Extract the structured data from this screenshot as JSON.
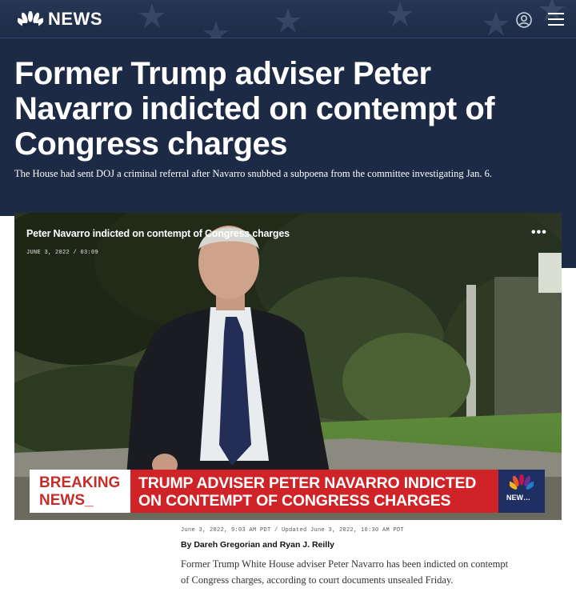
{
  "header": {
    "logo_text": "NEWS",
    "icons": [
      "nbc-peacock-icon",
      "account-icon",
      "hamburger-menu-icon"
    ],
    "colors": {
      "nav_bg": "#1d2c47",
      "hero_bg": "#1c2a45"
    }
  },
  "article": {
    "headline": "Former Trump adviser Peter Navarro indicted on contempt of Congress charges",
    "dek": "The House had sent DOJ a criminal referral after Navarro snubbed a subpoena from the committee investigating Jan. 6.",
    "timestamp": "June 3, 2022, 9:03 AM PDT / Updated June 3, 2022, 10:30 AM PDT",
    "byline": "By Dareh Gregorian and Ryan J. Reilly",
    "body": "Former Trump White House adviser Peter Navarro has been indicted on contempt of Congress charges, according to court documents unsealed Friday."
  },
  "video": {
    "title": "Peter Navarro indicted on contempt of Congress charges",
    "meta": "JUNE 3, 2022 / 03:09",
    "more_label": "•••",
    "lower_third": {
      "breaking_line1": "BREAKING",
      "breaking_line2": "NEWS_",
      "ticker_line1": "TRUMP ADVISER PETER NAVARRO INDICTED",
      "ticker_line2": "ON CONTEMPT OF CONGRESS CHARGES",
      "bug_label": "NEW…",
      "colors": {
        "breaking_text": "#c62d2a",
        "ticker_bg": "#cf2328",
        "bug_bg": "#1f2f63"
      }
    }
  }
}
